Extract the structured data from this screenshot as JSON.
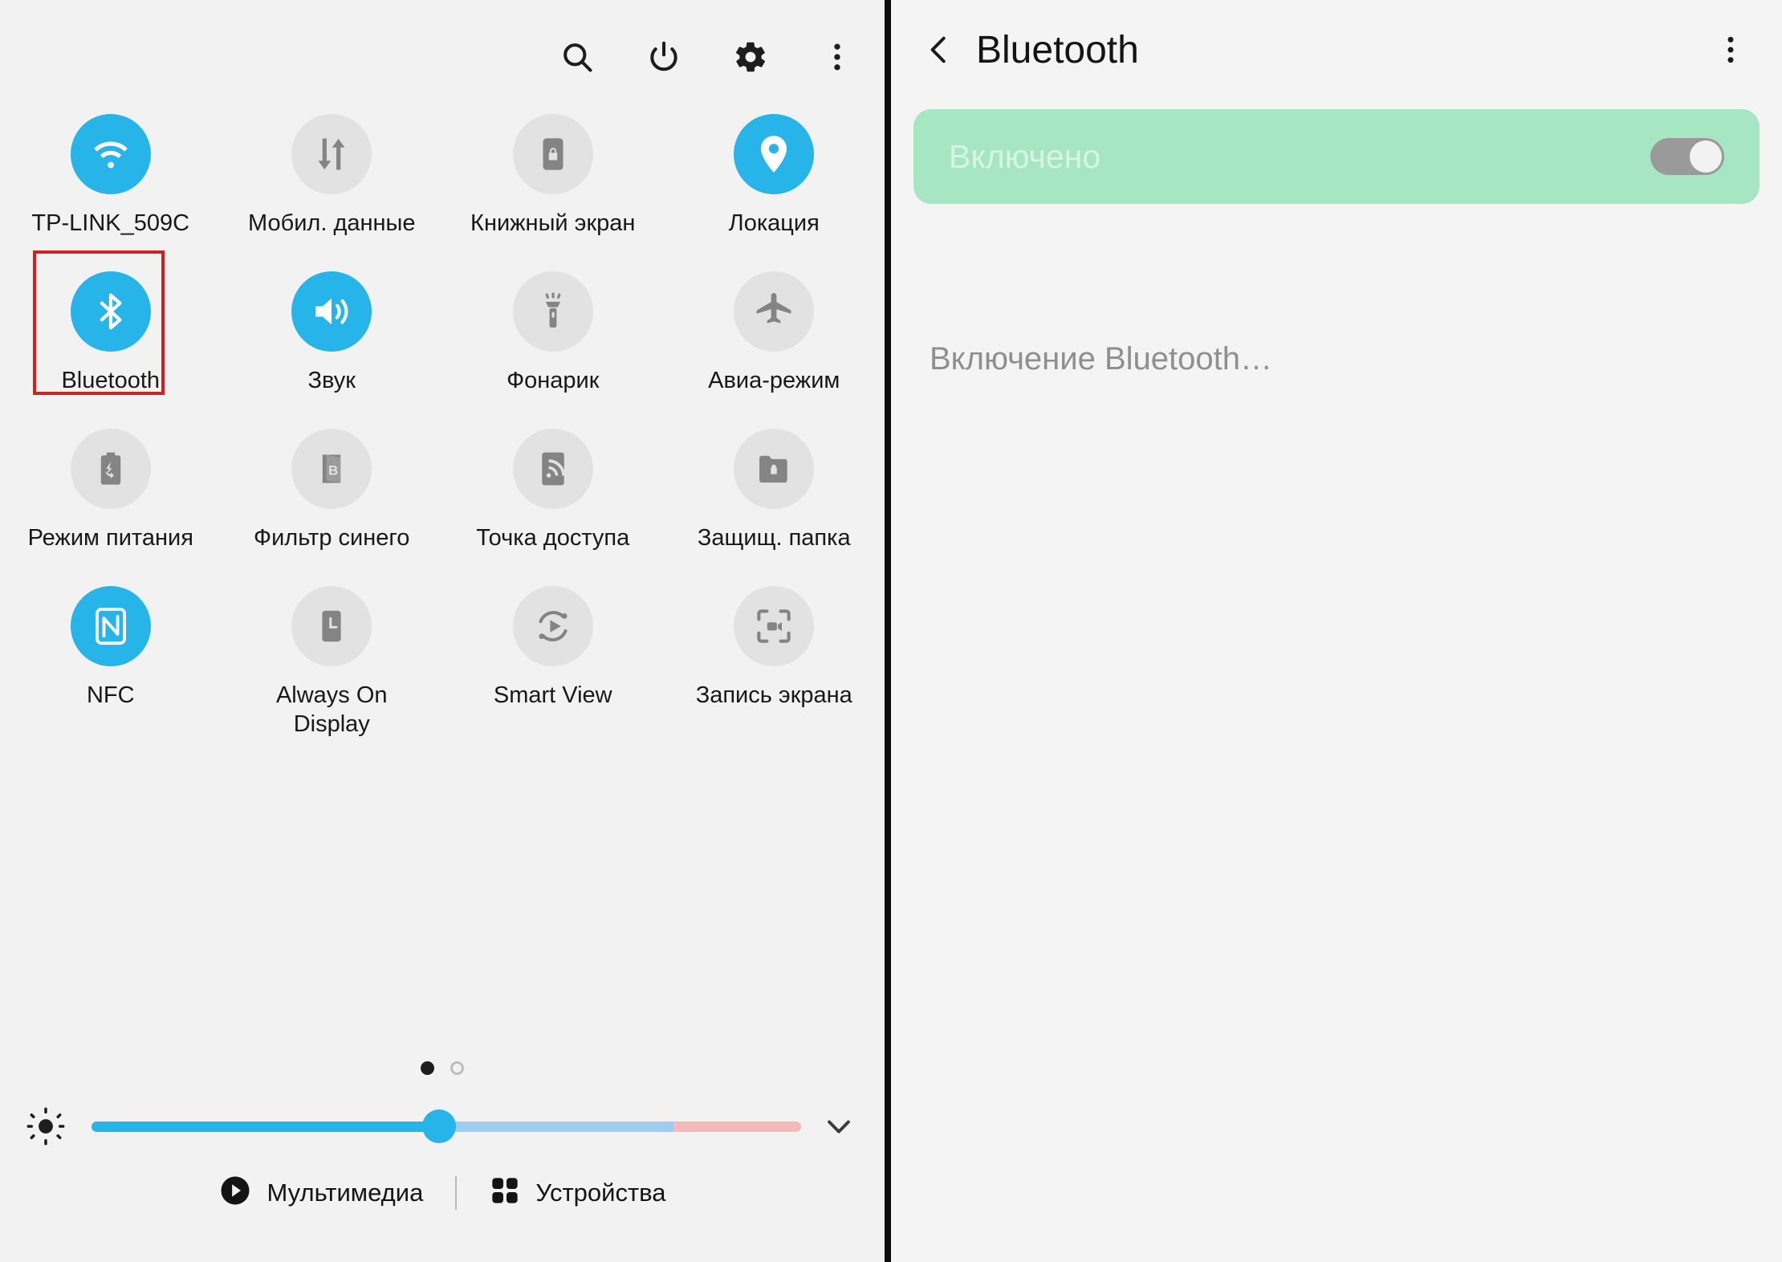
{
  "quick_settings": {
    "header_icons": [
      {
        "name": "search-icon",
        "label": "Поиск"
      },
      {
        "name": "power-icon",
        "label": "Питание"
      },
      {
        "name": "gear-icon",
        "label": "Настройки"
      },
      {
        "name": "more-vertical-icon",
        "label": "Меню"
      }
    ],
    "tiles": [
      {
        "label": "TP-LINK_509C",
        "icon": "wifi-icon",
        "state": "on"
      },
      {
        "label": "Мобил. данные",
        "icon": "mobile-data-icon",
        "state": "off"
      },
      {
        "label": "Книжный экран",
        "icon": "screen-rotation-lock-icon",
        "state": "off"
      },
      {
        "label": "Локация",
        "icon": "location-pin-icon",
        "state": "on"
      },
      {
        "label": "Bluetooth",
        "icon": "bluetooth-icon",
        "state": "on"
      },
      {
        "label": "Звук",
        "icon": "sound-icon",
        "state": "on"
      },
      {
        "label": "Фонарик",
        "icon": "flashlight-icon",
        "state": "off"
      },
      {
        "label": "Авиа-режим",
        "icon": "airplane-icon",
        "state": "off"
      },
      {
        "label": "Режим питания",
        "icon": "power-saving-icon",
        "state": "off"
      },
      {
        "label": "Фильтр синего",
        "icon": "blue-light-filter-icon",
        "state": "off"
      },
      {
        "label": "Точка доступа",
        "icon": "hotspot-icon",
        "state": "off"
      },
      {
        "label": "Защищ. папка",
        "icon": "secure-folder-icon",
        "state": "off"
      },
      {
        "label": "NFC",
        "icon": "nfc-icon",
        "state": "on"
      },
      {
        "label": "Always On Display",
        "icon": "always-on-display-icon",
        "state": "off"
      },
      {
        "label": "Smart View",
        "icon": "smart-view-icon",
        "state": "off"
      },
      {
        "label": "Запись экрана",
        "icon": "screen-record-icon",
        "state": "off"
      }
    ],
    "pagination": {
      "total": 2,
      "current": 1
    },
    "brightness": {
      "icon": "brightness-icon",
      "value_percent": 49,
      "expand_icon": "chevron-down-icon"
    },
    "bottom_bar": {
      "media": {
        "label": "Мультимедиа",
        "icon": "play-circle-icon"
      },
      "devices": {
        "label": "Устройства",
        "icon": "grid-squares-icon"
      }
    }
  },
  "bluetooth_page": {
    "back_icon": "chevron-left-icon",
    "title": "Bluetooth",
    "more_icon": "more-vertical-icon",
    "toggle": {
      "label": "Включено",
      "state": "on",
      "card_color": "#a6e6c3"
    },
    "status_text": "Включение Bluetooth…"
  },
  "annotation": {
    "highlight_target": "Bluetooth",
    "highlight_color": "#cc2222"
  },
  "colors": {
    "accent_blue": "#27b4e8",
    "tile_off_bg": "#e2e2e2",
    "panel_bg": "#f2f2f2",
    "green_card": "#a6e6c3"
  }
}
